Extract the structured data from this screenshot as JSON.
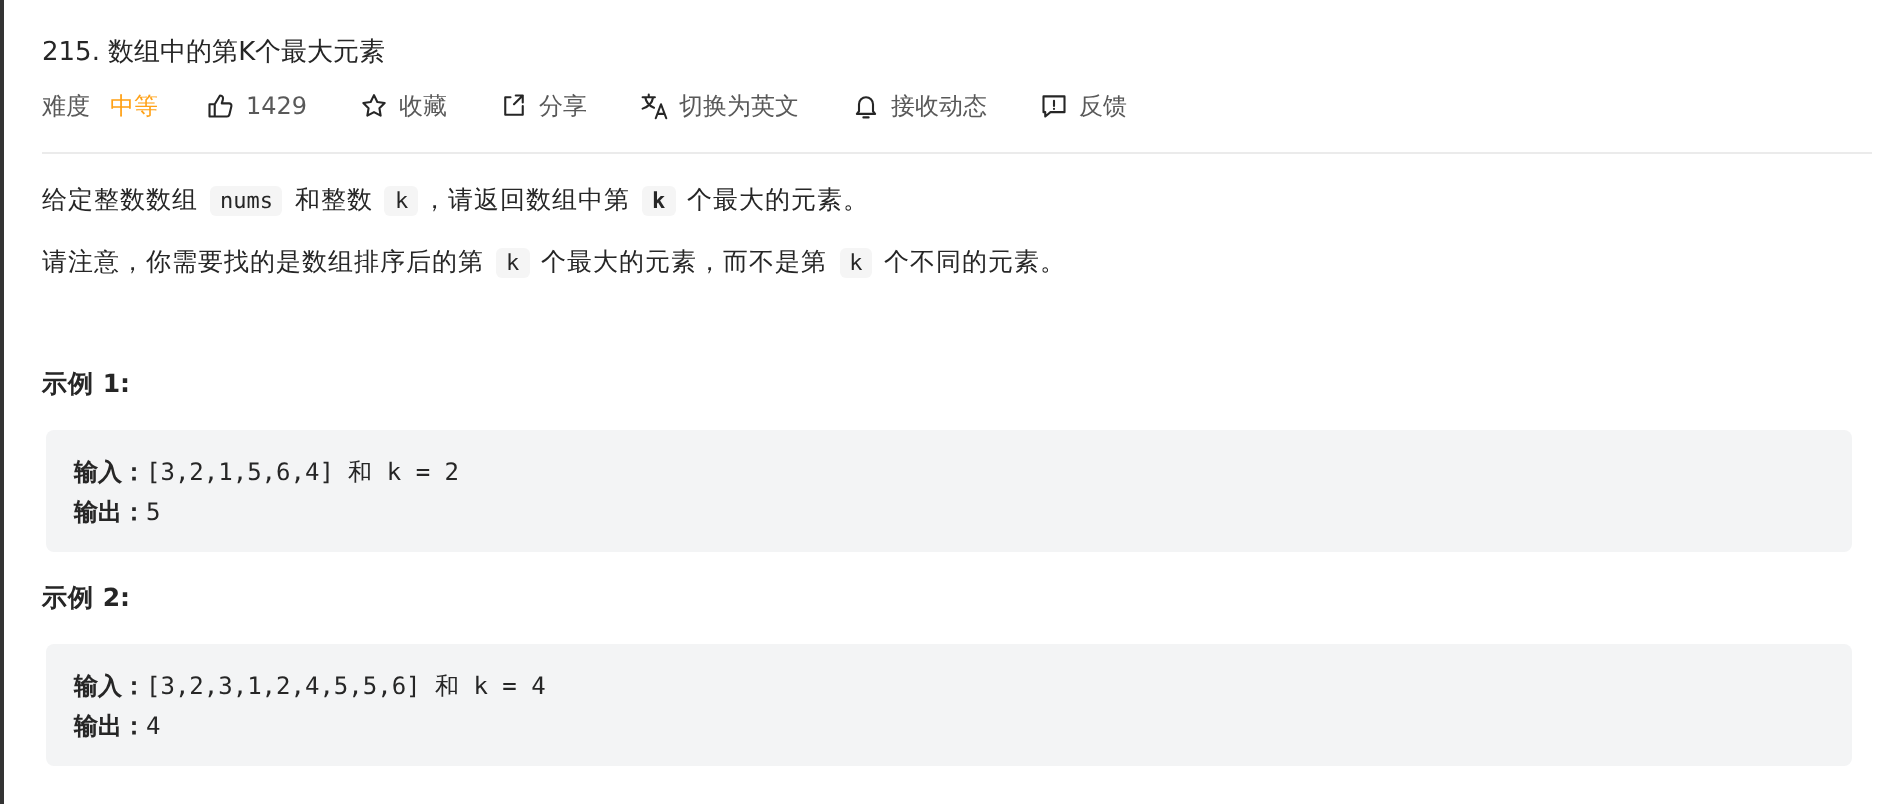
{
  "title": "215. 数组中的第K个最大元素",
  "meta": [
    {
      "kind": "difficulty",
      "label": "难度",
      "value": "中等"
    },
    {
      "kind": "like",
      "label": "1429"
    },
    {
      "kind": "star",
      "label": "收藏"
    },
    {
      "kind": "share",
      "label": "分享"
    },
    {
      "kind": "translate",
      "label": "切换为英文"
    },
    {
      "kind": "bell",
      "label": "接收动态"
    },
    {
      "kind": "feedback",
      "label": "反馈"
    }
  ],
  "paragraphs": [
    [
      {
        "kind": "text",
        "text": "给定整数数组 "
      },
      {
        "kind": "code",
        "text": "nums"
      },
      {
        "kind": "text",
        "text": " 和整数 "
      },
      {
        "kind": "code",
        "text": "k"
      },
      {
        "kind": "text",
        "text": "，请返回数组中第 "
      },
      {
        "kind": "code",
        "text": "**k**"
      },
      {
        "kind": "text",
        "text": " 个最大的元素。"
      }
    ],
    [
      {
        "kind": "text",
        "text": "请注意，你需要找的是数组排序后的第 "
      },
      {
        "kind": "code",
        "text": "k"
      },
      {
        "kind": "text",
        "text": " 个最大的元素，而不是第 "
      },
      {
        "kind": "code",
        "text": "k"
      },
      {
        "kind": "text",
        "text": " 个不同的元素。"
      }
    ]
  ],
  "examples": [
    {
      "heading": "示例 1:",
      "lines": [
        "**输入：**[3,2,1,5,6,4] 和 k = 2",
        "**输出：**5"
      ]
    },
    {
      "heading": "示例 2:",
      "lines": [
        "**输入：**[3,2,3,1,2,4,5,5,6] 和 k = 4",
        "**输出：**4"
      ]
    }
  ]
}
